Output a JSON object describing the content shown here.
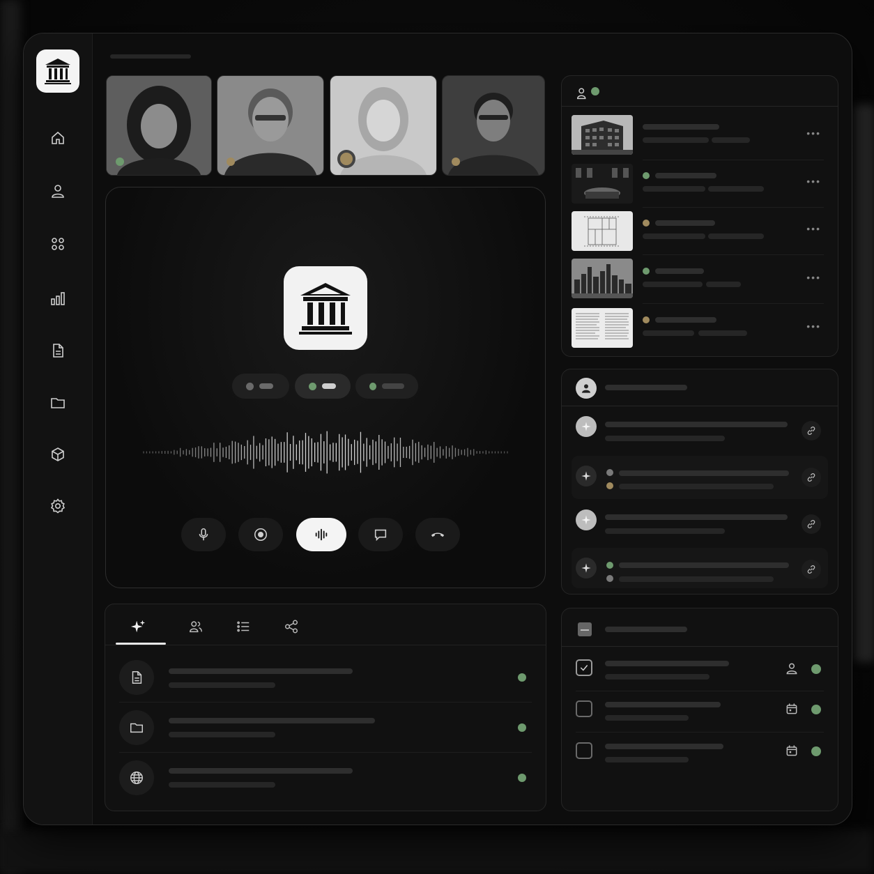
{
  "colors": {
    "status_green": "#6e9a6e",
    "status_tan": "#a08a5e",
    "accent_white": "#f4f4f4",
    "panel_bg": "#111111"
  },
  "sidebar": {
    "logo_icon": "institution-building-icon",
    "items": [
      {
        "icon": "home-icon"
      },
      {
        "icon": "user-icon"
      },
      {
        "icon": "apps-grid-icon"
      },
      {
        "icon": "bar-chart-icon"
      },
      {
        "icon": "document-icon"
      },
      {
        "icon": "folder-icon"
      },
      {
        "icon": "cube-icon"
      },
      {
        "icon": "settings-gear-icon"
      }
    ]
  },
  "participants": [
    {
      "status": "green"
    },
    {
      "status": "tan"
    },
    {
      "status": "tan"
    },
    {
      "status": "tan"
    }
  ],
  "call": {
    "logo_icon": "institution-building-icon",
    "mode_pills": [
      {
        "status": "grey",
        "selected": false
      },
      {
        "status": "green",
        "selected": true
      },
      {
        "status": "green",
        "selected": false
      }
    ],
    "controls": [
      {
        "icon": "microphone-icon",
        "active": false
      },
      {
        "icon": "record-icon",
        "active": false
      },
      {
        "icon": "audio-waveform-icon",
        "active": true
      },
      {
        "icon": "chat-bubble-icon",
        "active": false
      },
      {
        "icon": "hang-up-icon",
        "active": false
      }
    ]
  },
  "bottom_panel": {
    "tabs": [
      {
        "icon": "sparkle-icon",
        "active": true
      },
      {
        "icon": "users-icon",
        "active": false
      },
      {
        "icon": "list-icon",
        "active": false
      },
      {
        "icon": "share-icon",
        "active": false
      }
    ],
    "rows": [
      {
        "icon": "document-icon",
        "status": "green"
      },
      {
        "icon": "folder-icon",
        "status": "green"
      },
      {
        "icon": "globe-icon",
        "status": "green"
      }
    ]
  },
  "files_panel": {
    "header_icon": "users-status-icon",
    "items": [
      {
        "thumb": "building-photo",
        "status": null
      },
      {
        "thumb": "interior-photo",
        "status": "green"
      },
      {
        "thumb": "floor-plan",
        "status": "tan"
      },
      {
        "thumb": "city-skyline",
        "status": "green"
      },
      {
        "thumb": "text-document",
        "status": "tan"
      }
    ]
  },
  "insights_panel": {
    "header_icon": "person-avatar-icon",
    "items": [
      {
        "icon": "sparkle-icon",
        "highlight": true
      },
      {
        "icon": "sparkle-icon",
        "highlight": false
      },
      {
        "icon": "sparkle-icon",
        "highlight": true
      },
      {
        "icon": "sparkle-icon",
        "highlight": false
      }
    ]
  },
  "tasks_panel": {
    "header_icon": "document-thumbnail-icon",
    "items": [
      {
        "checked": true,
        "meta_icon": "person-icon",
        "status": "green"
      },
      {
        "checked": false,
        "meta_icon": "calendar-icon",
        "status": "green"
      },
      {
        "checked": false,
        "meta_icon": "calendar-icon",
        "status": "green"
      }
    ]
  }
}
